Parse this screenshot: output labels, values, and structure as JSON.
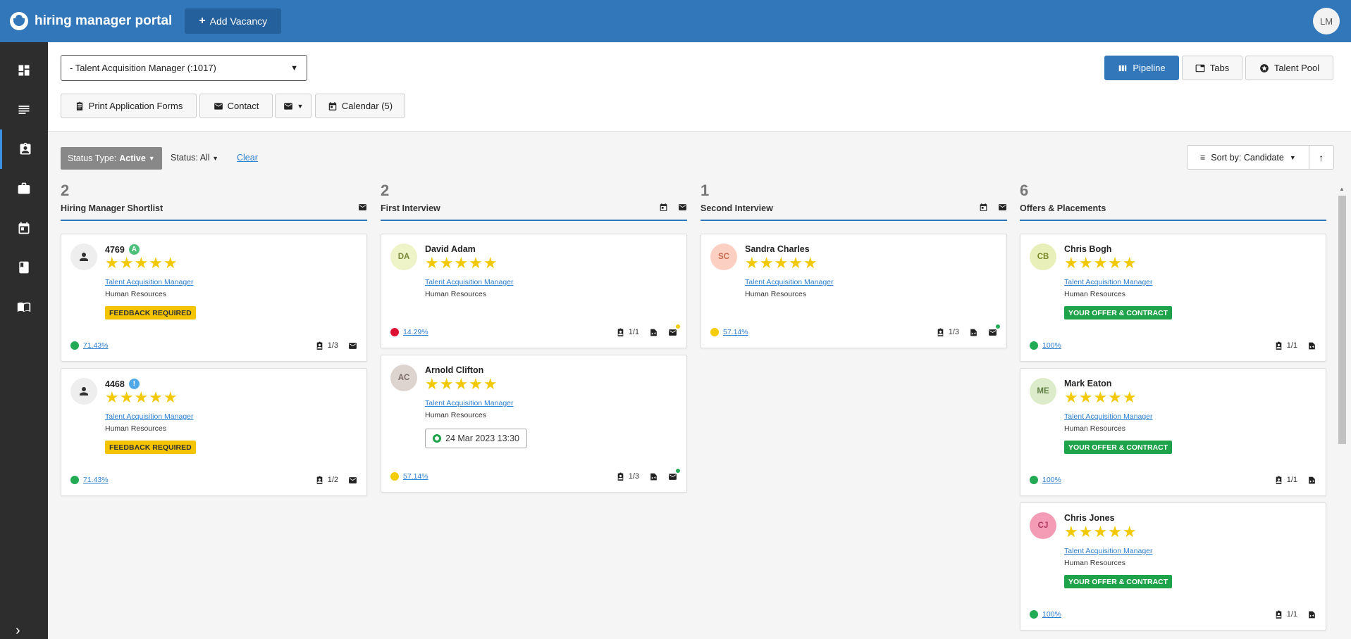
{
  "header": {
    "app_name": "hiring manager portal",
    "add_vacancy_label": "Add Vacancy",
    "user_initials": "LM"
  },
  "sidebar": {
    "items": [
      "dashboard-icon",
      "list-icon",
      "assignment-icon",
      "briefcase-icon",
      "calendar-icon",
      "book-icon",
      "menu-book-icon"
    ],
    "active_index": 2
  },
  "toolbar": {
    "vacancy_select": "- Talent Acquisition Manager (:1017)",
    "print_label": "Print Application Forms",
    "contact_label": "Contact",
    "calendar_label": "Calendar (5)",
    "views": {
      "pipeline": "Pipeline",
      "tabs": "Tabs",
      "talent_pool": "Talent Pool"
    }
  },
  "filters": {
    "status_type_prefix": "Status Type:",
    "status_type_value": "Active",
    "status_label": "Status: All",
    "clear_label": "Clear",
    "sort_label": "Sort by: Candidate"
  },
  "colors": {
    "brand": "#3377bb",
    "green": "#22aa55",
    "red": "#dd1133",
    "yellow": "#f5cc00"
  },
  "columns": [
    {
      "count": "2",
      "title": "Hiring Manager Shortlist",
      "cards": [
        {
          "name": "4769",
          "badge": "A",
          "badge_color": "#4cbf7a",
          "job": "Talent Acquisition Manager",
          "dept": "Human Resources",
          "tag": "FEEDBACK REQUIRED",
          "pct": "71.43%",
          "stage": "1/3"
        },
        {
          "name": "4468",
          "badge": "!",
          "badge_color": "#4fa8e8",
          "job": "Talent Acquisition Manager",
          "dept": "Human Resources",
          "tag": "FEEDBACK REQUIRED",
          "pct": "71.43%",
          "stage": "1/2"
        }
      ]
    },
    {
      "count": "2",
      "title": "First Interview",
      "cards": [
        {
          "name": "David Adam",
          "initials": "DA",
          "job": "Talent Acquisition Manager",
          "dept": "Human Resources",
          "pct": "14.29%",
          "stage": "1/1"
        },
        {
          "name": "Arnold Clifton",
          "initials": "AC",
          "job": "Talent Acquisition Manager",
          "dept": "Human Resources",
          "interview": "24 Mar 2023 13:30",
          "pct": "57.14%",
          "stage": "1/3"
        }
      ]
    },
    {
      "count": "1",
      "title": "Second Interview",
      "cards": [
        {
          "name": "Sandra Charles",
          "initials": "SC",
          "job": "Talent Acquisition Manager",
          "dept": "Human Resources",
          "pct": "57.14%",
          "stage": "1/3"
        }
      ]
    },
    {
      "count": "6",
      "title": "Offers & Placements",
      "cards": [
        {
          "name": "Chris Bogh",
          "initials": "CB",
          "job": "Talent Acquisition Manager",
          "dept": "Human Resources",
          "tag": "YOUR OFFER & CONTRACT",
          "pct": "100%",
          "stage": "1/1"
        },
        {
          "name": "Mark Eaton",
          "initials": "ME",
          "job": "Talent Acquisition Manager",
          "dept": "Human Resources",
          "tag": "YOUR OFFER & CONTRACT",
          "pct": "100%",
          "stage": "1/1"
        },
        {
          "name": "Chris Jones",
          "initials": "CJ",
          "job": "Talent Acquisition Manager",
          "dept": "Human Resources",
          "tag": "YOUR OFFER & CONTRACT",
          "pct": "100%",
          "stage": "1/1"
        }
      ]
    }
  ]
}
